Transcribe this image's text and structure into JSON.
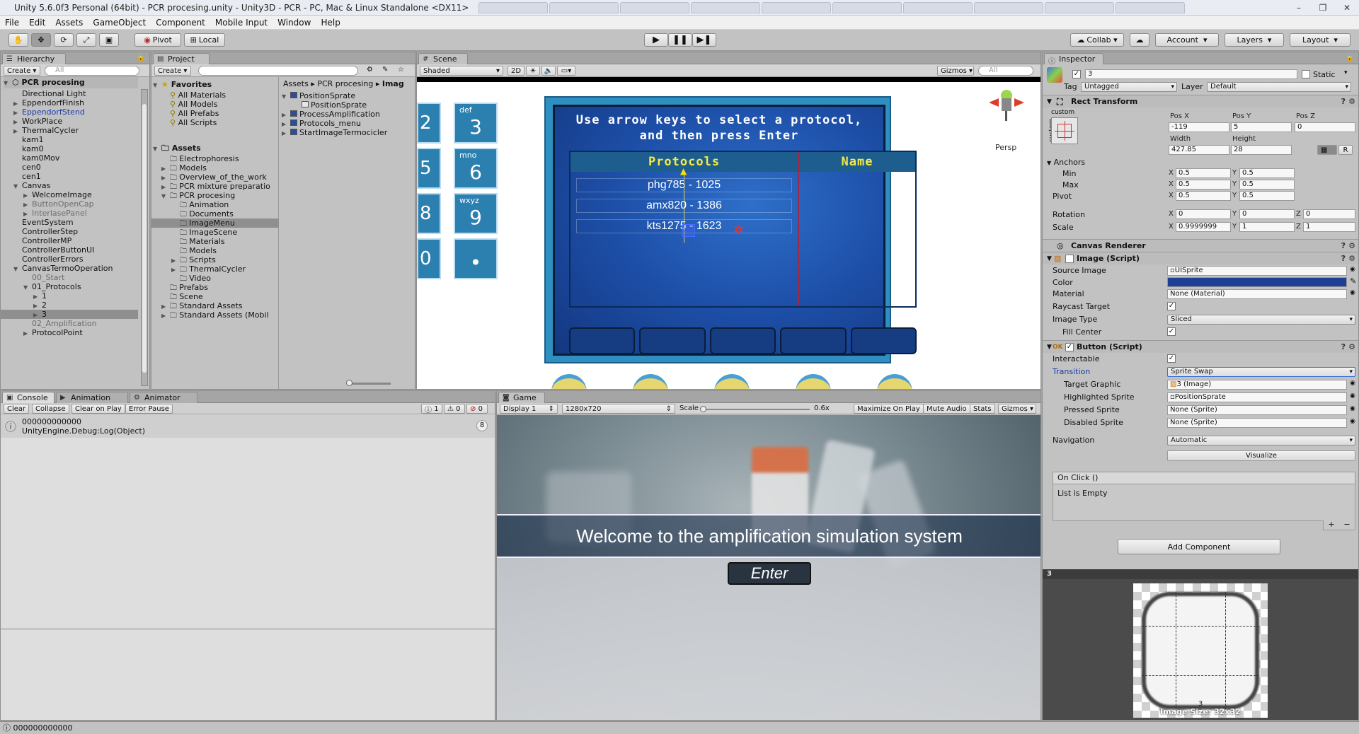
{
  "window": {
    "title": "Unity 5.6.0f3 Personal (64bit) - PCR procesing.unity - Unity3D - PCR - PC, Mac & Linux Standalone <DX11>",
    "min": "–",
    "max": "❐",
    "close": "✕"
  },
  "menu": [
    "File",
    "Edit",
    "Assets",
    "GameObject",
    "Component",
    "Mobile Input",
    "Window",
    "Help"
  ],
  "toolbar": {
    "pivot": "Pivot",
    "local": "Local",
    "collab": "Collab",
    "account": "Account",
    "layers": "Layers",
    "layout": "Layout"
  },
  "hierarchy": {
    "tab": "Hierarchy",
    "create": "Create",
    "search": "All",
    "scene": "PCR procesing",
    "items": [
      {
        "label": "Directional Light",
        "depth": 1,
        "arrow": "",
        "style": ""
      },
      {
        "label": "EppendorfFinish",
        "depth": 1,
        "arrow": "▶",
        "style": ""
      },
      {
        "label": "EppendorfStend",
        "depth": 1,
        "arrow": "▶",
        "style": "blue"
      },
      {
        "label": "WorkPlace",
        "depth": 1,
        "arrow": "▶",
        "style": ""
      },
      {
        "label": "ThermalCycler",
        "depth": 1,
        "arrow": "▶",
        "style": ""
      },
      {
        "label": "kam1",
        "depth": 1,
        "arrow": "",
        "style": ""
      },
      {
        "label": "kam0",
        "depth": 1,
        "arrow": "",
        "style": ""
      },
      {
        "label": "kam0Mov",
        "depth": 1,
        "arrow": "",
        "style": ""
      },
      {
        "label": "cen0",
        "depth": 1,
        "arrow": "",
        "style": ""
      },
      {
        "label": "cen1",
        "depth": 1,
        "arrow": "",
        "style": ""
      },
      {
        "label": "Canvas",
        "depth": 1,
        "arrow": "▼",
        "style": ""
      },
      {
        "label": "WelcomeImage",
        "depth": 2,
        "arrow": "▶",
        "style": ""
      },
      {
        "label": "ButtonOpenCap",
        "depth": 2,
        "arrow": "▶",
        "style": "grey"
      },
      {
        "label": "InterlasePanel",
        "depth": 2,
        "arrow": "▶",
        "style": "grey"
      },
      {
        "label": "EventSystem",
        "depth": 1,
        "arrow": "",
        "style": ""
      },
      {
        "label": "ControllerStep",
        "depth": 1,
        "arrow": "",
        "style": ""
      },
      {
        "label": "ControllerMP",
        "depth": 1,
        "arrow": "",
        "style": ""
      },
      {
        "label": "ControllerButtonUI",
        "depth": 1,
        "arrow": "",
        "style": ""
      },
      {
        "label": "ControllerErrors",
        "depth": 1,
        "arrow": "",
        "style": ""
      },
      {
        "label": "CanvasTermoOperation",
        "depth": 1,
        "arrow": "▼",
        "style": ""
      },
      {
        "label": "00_Start",
        "depth": 2,
        "arrow": "",
        "style": "grey"
      },
      {
        "label": "01_Protocols",
        "depth": 2,
        "arrow": "▼",
        "style": ""
      },
      {
        "label": "1",
        "depth": 3,
        "arrow": "▶",
        "style": ""
      },
      {
        "label": "2",
        "depth": 3,
        "arrow": "▶",
        "style": ""
      },
      {
        "label": "3",
        "depth": 3,
        "arrow": "▶",
        "style": "sel"
      },
      {
        "label": "02_Amplification",
        "depth": 2,
        "arrow": "",
        "style": "grey"
      },
      {
        "label": "ProtocolPoint",
        "depth": 2,
        "arrow": "▶",
        "style": ""
      }
    ]
  },
  "project": {
    "tab": "Project",
    "create": "Create",
    "favorites_label": "Favorites",
    "favorites": [
      "All Materials",
      "All Models",
      "All Prefabs",
      "All Scripts"
    ],
    "assets_label": "Assets",
    "tree": [
      {
        "label": "Electrophoresis",
        "depth": 1,
        "arrow": ""
      },
      {
        "label": "Models",
        "depth": 1,
        "arrow": "▶"
      },
      {
        "label": "Overview_of_the_work",
        "depth": 1,
        "arrow": "▶"
      },
      {
        "label": "PCR mixture preparatio",
        "depth": 1,
        "arrow": "▶"
      },
      {
        "label": "PCR procesing",
        "depth": 1,
        "arrow": "▼"
      },
      {
        "label": "Animation",
        "depth": 2,
        "arrow": ""
      },
      {
        "label": "Documents",
        "depth": 2,
        "arrow": ""
      },
      {
        "label": "ImageMenu",
        "depth": 2,
        "arrow": "",
        "sel": true
      },
      {
        "label": "ImageScene",
        "depth": 2,
        "arrow": ""
      },
      {
        "label": "Materials",
        "depth": 2,
        "arrow": ""
      },
      {
        "label": "Models",
        "depth": 2,
        "arrow": ""
      },
      {
        "label": "Scripts",
        "depth": 2,
        "arrow": "▶"
      },
      {
        "label": "ThermalCycler",
        "depth": 2,
        "arrow": "▶"
      },
      {
        "label": "Video",
        "depth": 2,
        "arrow": ""
      },
      {
        "label": "Prefabs",
        "depth": 1,
        "arrow": ""
      },
      {
        "label": "Scene",
        "depth": 1,
        "arrow": ""
      },
      {
        "label": "Standard Assets",
        "depth": 1,
        "arrow": "▶"
      },
      {
        "label": "Standard Assets (Mobil",
        "depth": 1,
        "arrow": "▶"
      }
    ],
    "breadcrumb": [
      "Assets",
      "PCR procesing",
      "Imag"
    ],
    "files": [
      {
        "label": "PositionSprate",
        "depth": 0,
        "arrow": "▼"
      },
      {
        "label": "PositionSprate",
        "depth": 1,
        "arrow": ""
      },
      {
        "label": "ProcessAmplification",
        "depth": 0,
        "arrow": "▶"
      },
      {
        "label": "Protocols_menu",
        "depth": 0,
        "arrow": "▶"
      },
      {
        "label": "StartImageTermocicler",
        "depth": 0,
        "arrow": "▶"
      }
    ]
  },
  "scene": {
    "tab": "Scene",
    "shading": "Shaded",
    "mode2d": "2D",
    "gizmos": "Gizmos",
    "search": "All",
    "persp": "Persp",
    "title_line1": "Use arrow keys to select a protocol,",
    "title_line2": "and then press Enter",
    "col_protocols": "Protocols",
    "col_name": "Name",
    "protocols": [
      "phg785 - 1025",
      "amx820 - 1386",
      "kts1275 - 1623"
    ],
    "keypad": [
      {
        "letters": "def",
        "digit": "3"
      },
      {
        "letters": "mno",
        "digit": "6"
      },
      {
        "letters": "wxyz",
        "digit": "9"
      },
      {
        "letters": "",
        "digit": "•"
      }
    ],
    "left_digits": [
      "2",
      "5",
      "8",
      "0"
    ]
  },
  "console": {
    "tabs": [
      "Console",
      "Animation",
      "Animator"
    ],
    "buttons": [
      "Clear",
      "Collapse",
      "Clear on Play",
      "Error Pause"
    ],
    "counts": {
      "info": "1",
      "warn": "0",
      "error": "0"
    },
    "message_line1": "000000000000",
    "message_line2": "UnityEngine.Debug:Log(Object)",
    "message_count": "8"
  },
  "game": {
    "tab": "Game",
    "display": "Display 1",
    "resolution": "1280x720",
    "scale_label": "Scale",
    "scale_value": "0.6x",
    "maximize": "Maximize On Play",
    "mute": "Mute Audio",
    "stats": "Stats",
    "gizmos": "Gizmos",
    "welcome": "Welcome to the amplification simulation system",
    "enter": "Enter"
  },
  "inspector": {
    "tab": "Inspector",
    "object_name": "3",
    "static_label": "Static",
    "tag_label": "Tag",
    "tag": "Untagged",
    "layer_label": "Layer",
    "layer": "Default",
    "rect": {
      "title": "Rect Transform",
      "anchor_mode": "custom",
      "side_label": "custom",
      "posx_label": "Pos X",
      "posy_label": "Pos Y",
      "posz_label": "Pos Z",
      "posx": "-119",
      "posy": "5",
      "posz": "0",
      "width_label": "Width",
      "height_label": "Height",
      "width": "427.85",
      "height": "28",
      "r_btn": "R",
      "anchors": "Anchors",
      "min": "Min",
      "max": "Max",
      "pivot": "Pivot",
      "min_x": "0.5",
      "min_y": "0.5",
      "max_x": "0.5",
      "max_y": "0.5",
      "pivot_x": "0.5",
      "pivot_y": "0.5",
      "rotation": "Rotation",
      "rot_x": "0",
      "rot_y": "0",
      "rot_z": "0",
      "scale": "Scale",
      "scale_x": "0.9999999",
      "scale_y": "1",
      "scale_z": "1"
    },
    "canvas_renderer": "Canvas Renderer",
    "image": {
      "title": "Image (Script)",
      "source_label": "Source Image",
      "source": "UISprite",
      "color_label": "Color",
      "color": "#1e3f94",
      "material_label": "Material",
      "material": "None (Material)",
      "raycast_label": "Raycast Target",
      "type_label": "Image Type",
      "type": "Sliced",
      "fill_label": "Fill Center"
    },
    "button": {
      "title": "Button (Script)",
      "interactable_label": "Interactable",
      "transition_label": "Transition",
      "transition": "Sprite Swap",
      "target_label": "Target Graphic",
      "target": "3 (Image)",
      "highlighted_label": "Highlighted Sprite",
      "highlighted": "PositionSprate",
      "pressed_label": "Pressed Sprite",
      "pressed": "None (Sprite)",
      "disabled_label": "Disabled Sprite",
      "disabled": "None (Sprite)",
      "navigation_label": "Navigation",
      "navigation": "Automatic",
      "visualize": "Visualize",
      "onclick": "On Click ()",
      "list_empty": "List is Empty",
      "plus": "+",
      "minus": "−"
    },
    "add_component": "Add Component",
    "preview_title": "3",
    "preview_caption": "Image Size: 32x32",
    "preview_index": "3"
  },
  "status": "000000000000"
}
